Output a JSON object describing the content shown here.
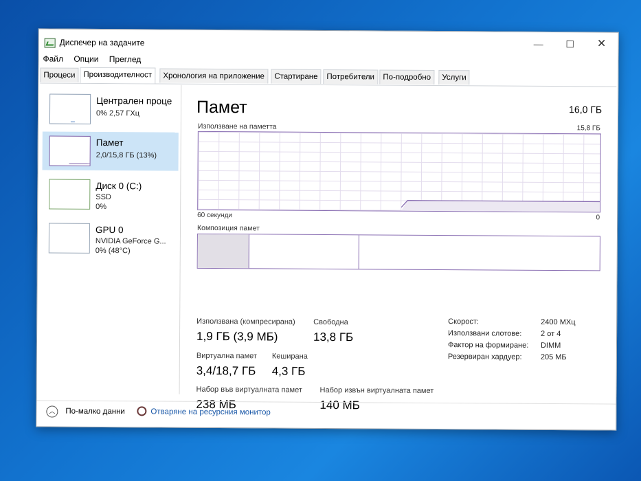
{
  "window": {
    "title": "Диспечер на задачите",
    "controls": {
      "minimize": "—",
      "maximize": "☐",
      "close": "✕"
    }
  },
  "menu": [
    "Файл",
    "Опции",
    "Преглед"
  ],
  "tabs": [
    {
      "label": "Процеси",
      "active": false
    },
    {
      "label": "Производителност",
      "active": true
    },
    {
      "label": "Хронология на приложение",
      "active": false
    },
    {
      "label": "Стартиране",
      "active": false
    },
    {
      "label": "Потребители",
      "active": false
    },
    {
      "label": "По-подробно",
      "active": false
    },
    {
      "label": "Услуги",
      "active": false
    }
  ],
  "sidebar": [
    {
      "title": "Централен проце",
      "line1": "0% 2,57 ГХц",
      "line2": "",
      "selected": false
    },
    {
      "title": "Памет",
      "line1": "2,0/15,8 ГБ (13%)",
      "line2": "",
      "selected": true
    },
    {
      "title": "Диск 0 (C:)",
      "line1": "SSD",
      "line2": "0%",
      "selected": false
    },
    {
      "title": "GPU 0",
      "line1": "NVIDIA GeForce G...",
      "line2": "0% (48°C)",
      "selected": false
    }
  ],
  "memory": {
    "title": "Памет",
    "total": "16,0 ГБ",
    "usage_label": "Използване на паметта",
    "usage_max": "15,8 ГБ",
    "axis_left": "60 секунди",
    "axis_right": "0",
    "composition_label": "Композиция памет",
    "stats": {
      "in_use_label": "Използвана (компресирана)",
      "in_use_value": "1,9 ГБ (3,9 МБ)",
      "available_label": "Свободна",
      "available_value": "13,8 ГБ",
      "committed_label": "Виртуална памет",
      "committed_value": "3,4/18,7 ГБ",
      "cached_label": "Кеширана",
      "cached_value": "4,3 ГБ",
      "paged_label": "Набор във виртуалната памет",
      "paged_value": "238 МБ",
      "nonpaged_label": "Набор извън виртуалната памет",
      "nonpaged_value": "140 МБ"
    },
    "hardware": [
      {
        "label": "Скорост:",
        "value": "2400 MXц"
      },
      {
        "label": "Използвани слотове:",
        "value": "2 от 4"
      },
      {
        "label": "Фактор на формиране:",
        "value": "DIMM"
      },
      {
        "label": "Резервиран хардуер:",
        "value": "205 МБ"
      }
    ]
  },
  "footer": {
    "fewer_details": "По-малко данни",
    "open_monitor": "Отваряне на ресурсния монитор"
  }
}
